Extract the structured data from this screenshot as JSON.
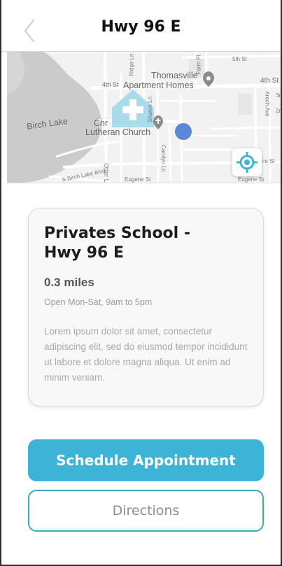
{
  "header": {
    "title": "Hwy 96 E",
    "back_icon": "chevron-left-icon"
  },
  "map": {
    "labels": {
      "lake": "Birch Lake",
      "thomasville": "Thomasville",
      "apartments": "Apartment Homes",
      "street_4th_left": "4th St",
      "street_4th_right": "4th St",
      "street_5th": "5th St",
      "church_1": "Chr",
      "church_2": "Lutheran Church",
      "birch_lake_blvd": "S Birch Lake Blvd",
      "eugene_1": "Eugene St",
      "eugene_2": "Eugene St",
      "otter": "Otter L",
      "carolyn": "Carolyn Ln",
      "sharon": "Sharon Ln",
      "krech": "Krech Ave",
      "ince": "nce St",
      "two_n": "2n",
      "three": "3r",
      "ridge": "Ridge Ln",
      "farm": "Farm Pl"
    },
    "colors": {
      "water": "#cbcbcb",
      "road": "#ffffff",
      "pin": "#5b89d8",
      "marker": "#a9dceb",
      "poi": "#8a8a8a"
    },
    "icons": [
      "clinic-marker-icon",
      "poi-pin-icon",
      "current-location-dot-icon",
      "my-location-icon"
    ]
  },
  "card": {
    "title": "Privates School - Hwy 96 E",
    "distance": "0.3 miles",
    "hours": "Open Mon-Sat, 9am to 5pm",
    "description": "Lorem ipsum dolor sit amet, consectetur adipiscing elit, sed do eiusmod tempor incididunt ut labore et dolore magna aliqua. Ut enim ad minim veniam."
  },
  "buttons": {
    "schedule": "Schedule Appointment",
    "directions": "Directions"
  },
  "colors": {
    "accent": "#3db4d6",
    "accent_border": "#3aa8c7"
  }
}
